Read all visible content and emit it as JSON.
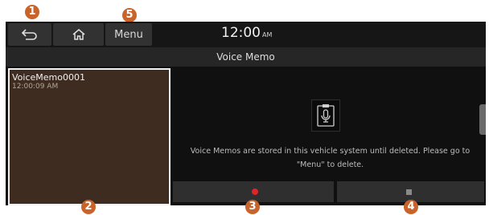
{
  "callouts": {
    "c1": "1",
    "c2": "2",
    "c3": "3",
    "c4": "4",
    "c5": "5"
  },
  "statusbar": {
    "back_icon": "back-arrow-icon",
    "home_icon": "home-icon",
    "menu_label": "Menu",
    "time": "12:00",
    "ampm": "AM"
  },
  "header": {
    "title": "Voice Memo"
  },
  "memo_list": {
    "items": [
      {
        "name": "VoiceMemo0001",
        "time": "12:00:09 AM"
      }
    ]
  },
  "main": {
    "icon": "voice-memo-mic-icon",
    "info_text": "Voice Memos are stored in this vehicle system until deleted. Please go to \"Menu\" to delete."
  },
  "controls": {
    "record_icon": "record-icon",
    "stop_icon": "stop-icon"
  },
  "colors": {
    "callout": "#c9632c",
    "record": "#e0252a",
    "list_bg": "#3d2c1f",
    "screen_bg": "#101010"
  }
}
